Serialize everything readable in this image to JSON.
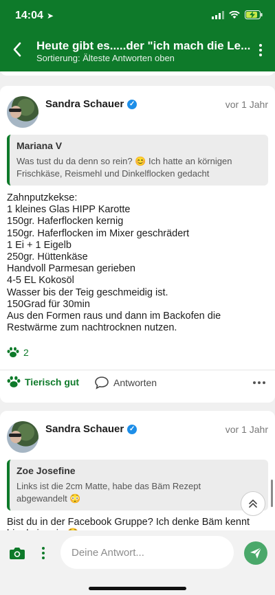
{
  "status_bar": {
    "time": "14:04"
  },
  "header": {
    "title": "Heute gibt es.....der \"ich mach die Le...",
    "subtitle": "Sortierung: Älteste Antworten oben"
  },
  "posts": [
    {
      "author": "Sandra Schauer",
      "time_ago": "vor 1 Jahr",
      "quote_author": "Mariana V",
      "quote_text": "Was tust du da denn so rein? 😊 Ich hatte an körnigen Frischkäse, Reismehl und Dinkelflocken gedacht",
      "body": "Zahnputzkekse:\n1 kleines Glas HIPP Karotte\n150gr. Haferflocken kernig\n150gr. Haferflocken im Mixer geschrädert\n1 Ei + 1 Eigelb\n250gr. Hüttenkäse\nHandvoll Parmesan gerieben\n4-5 EL Kokosöl\nWasser bis der Teig geschmeidig ist.\n150Grad für 30min\nAus den Formen raus und dann im Backofen die Restwärme zum nachtrocknen nutzen.",
      "like_count": "2",
      "like_label": "Tierisch gut",
      "reply_label": "Antworten"
    },
    {
      "author": "Sandra Schauer",
      "time_ago": "vor 1 Jahr",
      "quote_author": "Zoe Josefine",
      "quote_text": "Links ist die 2cm Matte, habe das Bäm Rezept abgewandelt 😳",
      "body": "Bist du in der Facebook Gruppe? Ich denke Bäm kennt hier keiner ja 😳"
    }
  ],
  "composer": {
    "placeholder": "Deine Antwort..."
  },
  "colors": {
    "brand": "#0e7a2a",
    "send": "#4aa86a"
  }
}
